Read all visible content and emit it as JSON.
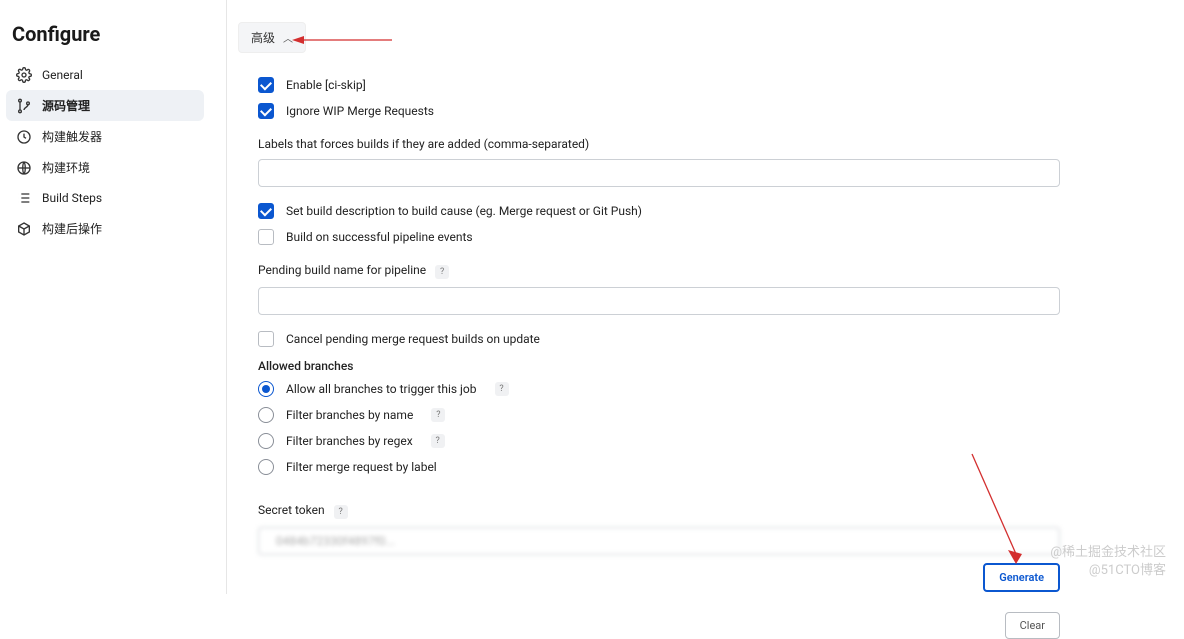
{
  "page_title": "Configure",
  "sidebar": {
    "items": [
      {
        "label": "General",
        "active": false
      },
      {
        "label": "源码管理",
        "active": true
      },
      {
        "label": "构建触发器",
        "active": false
      },
      {
        "label": "构建环境",
        "active": false
      },
      {
        "label": "Build Steps",
        "active": false
      },
      {
        "label": "构建后操作",
        "active": false
      }
    ]
  },
  "advanced_toggle": "高级",
  "form": {
    "enable_ci_skip": {
      "label": "Enable [ci-skip]",
      "checked": true
    },
    "ignore_wip": {
      "label": "Ignore WIP Merge Requests",
      "checked": true
    },
    "labels_force_builds": {
      "label": "Labels that forces builds if they are added (comma-separated)",
      "value": ""
    },
    "set_build_desc": {
      "label": "Set build description to build cause (eg. Merge request or Git Push)",
      "checked": true
    },
    "build_on_pipeline": {
      "label": "Build on successful pipeline events",
      "checked": false
    },
    "pending_build_name": {
      "label": "Pending build name for pipeline",
      "value": ""
    },
    "cancel_pending": {
      "label": "Cancel pending merge request builds on update",
      "checked": false
    },
    "allowed_branches_label": "Allowed branches",
    "branch_options": [
      {
        "label": "Allow all branches to trigger this job",
        "checked": true,
        "help": true
      },
      {
        "label": "Filter branches by name",
        "checked": false,
        "help": true
      },
      {
        "label": "Filter branches by regex",
        "checked": false,
        "help": true
      },
      {
        "label": "Filter merge request by label",
        "checked": false,
        "help": false
      }
    ],
    "secret_token": {
      "label": "Secret token",
      "value": "   0484b72330f4897f0..."
    },
    "generate_btn": "Generate",
    "clear_btn": "Clear"
  },
  "watermark": {
    "line1": "@稀土掘金技术社区",
    "line2": "@51CTO博客"
  }
}
